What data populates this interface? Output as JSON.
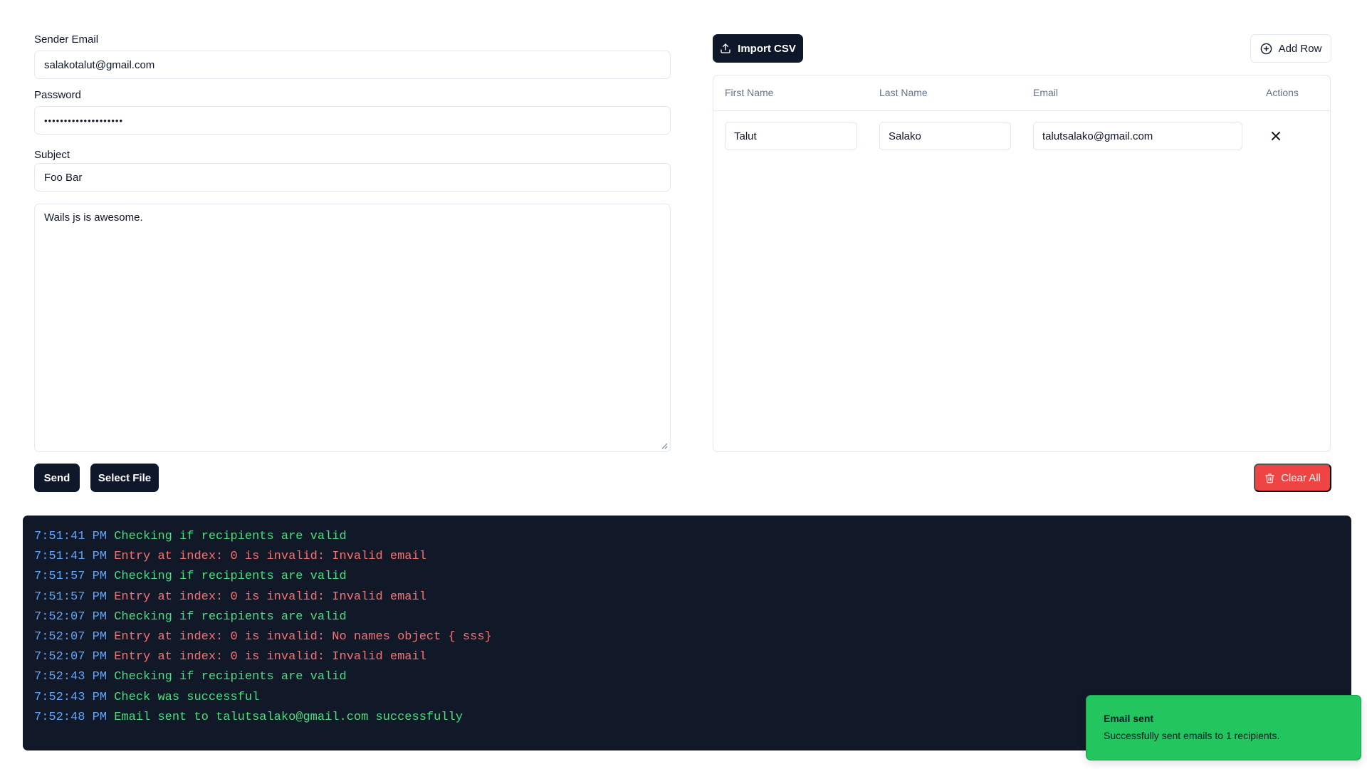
{
  "form": {
    "sender_email_label": "Sender Email",
    "sender_email_value": "salakotalut@gmail.com",
    "password_label": "Password",
    "password_value": "••••••••••••••••••••",
    "subject_label": "Subject",
    "subject_value": "Foo Bar",
    "body_value": "Wails js is awesome.",
    "send_label": "Send",
    "select_file_label": "Select File"
  },
  "recipients": {
    "import_csv_label": "Import CSV",
    "add_row_label": "Add Row",
    "clear_all_label": "Clear All",
    "columns": [
      "First Name",
      "Last Name",
      "Email",
      "Actions"
    ],
    "rows": [
      {
        "first_name": "Talut",
        "last_name": "Salako",
        "email": "talutsalako@gmail.com"
      }
    ]
  },
  "console": {
    "lines": [
      {
        "time": "7:51:41 PM",
        "message": "Checking if recipients are valid",
        "level": "info"
      },
      {
        "time": "7:51:41 PM",
        "message": "Entry at index: 0 is invalid: Invalid email",
        "level": "error"
      },
      {
        "time": "7:51:57 PM",
        "message": "Checking if recipients are valid",
        "level": "info"
      },
      {
        "time": "7:51:57 PM",
        "message": "Entry at index: 0 is invalid: Invalid email",
        "level": "error"
      },
      {
        "time": "7:52:07 PM",
        "message": "Checking if recipients are valid",
        "level": "info"
      },
      {
        "time": "7:52:07 PM",
        "message": "Entry at index: 0 is invalid: No names object { sss}",
        "level": "error"
      },
      {
        "time": "7:52:07 PM",
        "message": "Entry at index: 0 is invalid: Invalid email",
        "level": "error"
      },
      {
        "time": "7:52:43 PM",
        "message": "Checking if recipients are valid",
        "level": "info"
      },
      {
        "time": "7:52:43 PM",
        "message": "Check was successful",
        "level": "info"
      },
      {
        "time": "7:52:48 PM",
        "message": "Email sent to talutsalako@gmail.com successfully",
        "level": "info"
      }
    ]
  },
  "toast": {
    "title": "Email sent",
    "description": "Successfully sent emails to 1 recipients."
  },
  "colors": {
    "primary": "#0f172a",
    "destructive": "#ef4444",
    "success": "#22c55e",
    "console_bg": "#111827",
    "log_time": "#60a5fa",
    "log_info": "#4ade80",
    "log_error": "#f87171"
  },
  "icons": {
    "import": "upload-icon",
    "add_row": "plus-circle-icon",
    "clear_all": "trash-icon",
    "remove_row": "close-icon"
  }
}
